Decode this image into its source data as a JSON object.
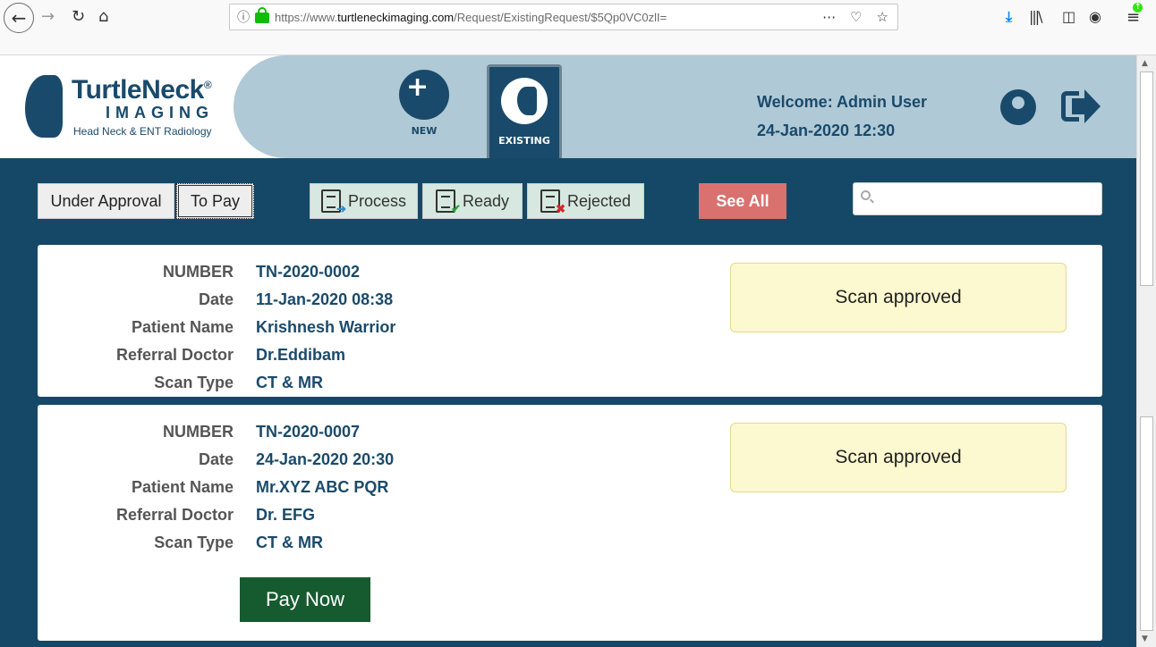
{
  "browser": {
    "url_prefix": "https://www.",
    "url_domain": "turtleneckimaging.com",
    "url_path": "/Request/ExistingRequest/$5Qp0VC0zlI="
  },
  "header": {
    "brand_name": "TurtleNeck",
    "brand_mark": "®",
    "brand_sub": "IMAGING",
    "brand_tagline": "Head Neck & ENT Radiology",
    "nav_new_label": "NEW",
    "nav_existing_label": "EXISTING",
    "welcome": "Welcome: Admin User",
    "datetime": "24-Jan-2020 12:30"
  },
  "filters": {
    "under_approval": "Under Approval",
    "to_pay": "To Pay",
    "process": "Process",
    "ready": "Ready",
    "rejected": "Rejected",
    "see_all": "See All",
    "search_placeholder": ""
  },
  "labels": {
    "number": "NUMBER",
    "date": "Date",
    "patient_name": "Patient Name",
    "referral_doctor": "Referral Doctor",
    "scan_type": "Scan Type"
  },
  "requests": [
    {
      "number": "TN-2020-0002",
      "date": "11-Jan-2020 08:38",
      "patient_name": "Krishnesh Warrior",
      "referral_doctor": "Dr.Eddibam",
      "scan_type": "CT & MR",
      "status": "Scan approved"
    },
    {
      "number": "TN-2020-0007",
      "date": "24-Jan-2020 20:30",
      "patient_name": "Mr.XYZ ABC PQR",
      "referral_doctor": "Dr. EFG",
      "scan_type": "CT & MR",
      "status": "Scan approved",
      "action": "Pay Now"
    }
  ],
  "colors": {
    "header_bg": "#b0c9d6",
    "panel_bg": "#154866",
    "brand": "#1a4a6b",
    "see_all": "#d9716f",
    "pay_now": "#165b2f",
    "status_bg": "#fcf8cf"
  }
}
